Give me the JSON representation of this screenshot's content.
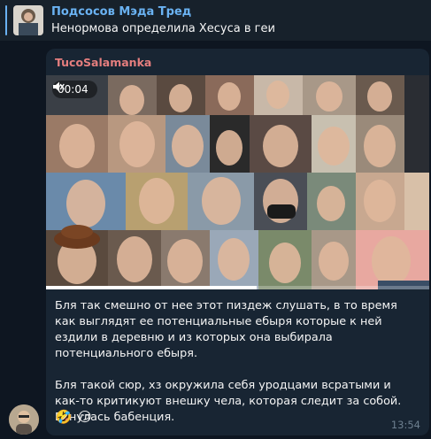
{
  "reply": {
    "title": "Подсосов Мэда Тред",
    "text": "Ненормова определила Хесуса в геи"
  },
  "message": {
    "sender": "TucoSalamanka",
    "video": {
      "time": "00:04",
      "muted_icon": "speaker-muted-icon",
      "progress": 0.55
    },
    "paragraphs": [
      "Бля так смешно от нее этот пиздеж слушать, в то время как выглядят ее потенциальные ебыря которые к ней ездили в деревню и из которых она выбирала потенциального ебыря.",
      "Бля такой сюр, хз окружила себя уродцами всратыми и как-то критикуют внешку чела, которая следит за собой.",
      "Ебнулась бабенция."
    ],
    "reactions": [
      "🤣",
      "😏"
    ],
    "time": "13:54"
  },
  "colors": {
    "background": "#0e1621",
    "bubble": "#182533",
    "accent": "#6ab2f2",
    "sender": "#e57e7e"
  }
}
